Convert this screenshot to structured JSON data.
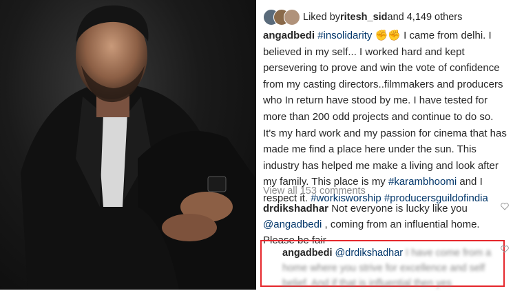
{
  "likes": {
    "prefix": "Liked by ",
    "user": "ritesh_sid",
    "suffix": " and 4,149 others"
  },
  "post": {
    "username": "angadbedi",
    "hashtag": "#insolidarity",
    "emoji": "✊✊",
    "text1": " I came from delhi. I believed in my self... I worked hard and kept persevering to prove and win the vote of confidence from my casting directors..filmmakers and producers who In return have stood by me. I have tested for more than 200 odd projects and continue to do so. It's my hard work and my passion for cinema that has made me find a place here under the sun. This industry has helped me make a living and look after my family. This place is my ",
    "tag2": "#karambhoomi",
    "text2": " and I respect it. ",
    "tag3": "#workisworship",
    "tag4": "#producersguildofindia"
  },
  "view_all": "View all 153 comments",
  "comment1": {
    "username": "drdikshadhar",
    "text1": " Not everyone is lucky like you ",
    "mention": "@angadbedi",
    "text2": " , coming from an influential home. Please be fair"
  },
  "reply": {
    "username": "angadbedi",
    "mention": "@drdikshadhar",
    "blurred_text": " I have come from a home where you strive for excellence and self belief. And if that is influential then yes"
  },
  "colors": {
    "highlight": "#e5272c",
    "link": "#003569",
    "muted": "#8e8e8e"
  }
}
